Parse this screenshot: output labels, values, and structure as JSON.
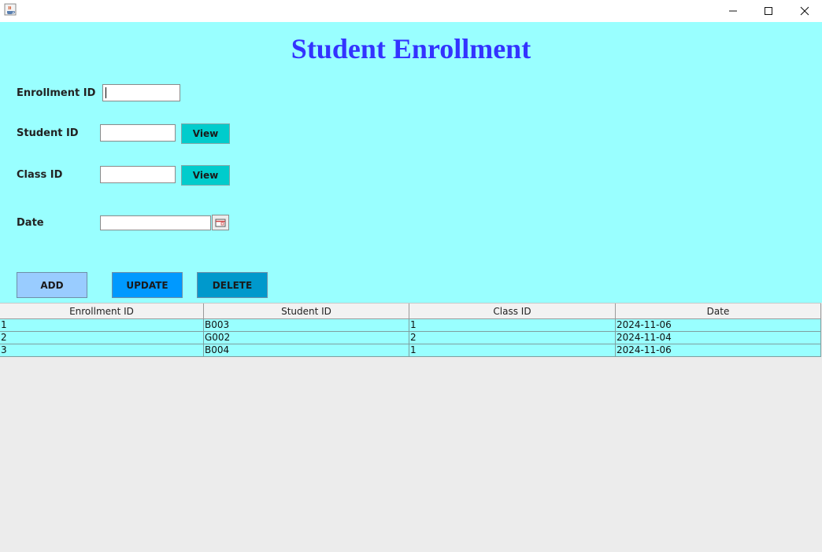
{
  "window": {
    "app_icon": "java-cup-icon",
    "controls": [
      "minimize-icon",
      "maximize-icon",
      "close-icon"
    ]
  },
  "title": "Student Enrollment",
  "colors": {
    "panel_bg": "#99ffff",
    "title": "#3333ff",
    "view_button": "#00cccc",
    "add_button": "#99ccff",
    "update_button": "#0099ff",
    "delete_button": "#0099cc",
    "table_bg": "#ececec"
  },
  "form": {
    "enrollment_id": {
      "label": "Enrollment ID",
      "value": ""
    },
    "student_id": {
      "label": "Student ID",
      "value": "",
      "view_label": "View"
    },
    "class_id": {
      "label": "Class ID",
      "value": "",
      "view_label": "View"
    },
    "date": {
      "label": "Date",
      "value": "",
      "icon": "calendar-icon"
    }
  },
  "actions": {
    "add": "ADD",
    "update": "UPDATE",
    "delete": "DELETE"
  },
  "table": {
    "columns": [
      "Enrollment ID",
      "Student ID",
      "Class ID",
      "Date"
    ],
    "rows": [
      [
        "1",
        "B003",
        "1",
        "2024-11-06"
      ],
      [
        "2",
        "G002",
        "2",
        "2024-11-04"
      ],
      [
        "3",
        "B004",
        "1",
        "2024-11-06"
      ]
    ]
  }
}
